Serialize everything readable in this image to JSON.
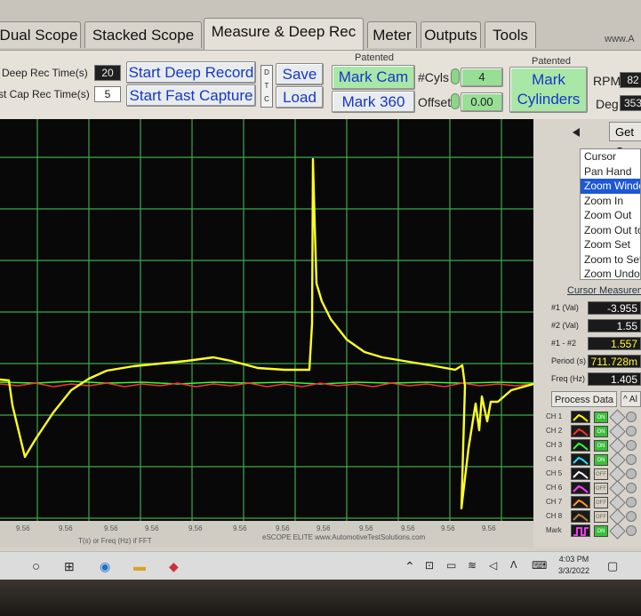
{
  "tabs": [
    "Dual Scope",
    "Stacked Scope",
    "Measure & Deep Rec",
    "Meter",
    "Outputs",
    "Tools"
  ],
  "active_tab": "Measure & Deep Rec",
  "url_fragment": "www.A",
  "controls": {
    "deep_rec_label": "Deep Rec Time(s)",
    "deep_rec_value": "20",
    "fast_cap_label": "st Cap Rec Time(s)",
    "fast_cap_value": "5",
    "start_deep_record": "Start Deep Record",
    "start_fast_capture": "Start Fast Capture",
    "dtc": "D T C",
    "save": "Save",
    "load": "Load",
    "patented_1": "Patented",
    "mark_cam": "Mark Cam",
    "mark_360": "Mark 360",
    "cyls_label": "#Cyls",
    "cyls_value": "4",
    "offset_label": "Offset",
    "offset_value": "0.00",
    "patented_2": "Patented",
    "mark_cylinders": "Mark Cylinders",
    "rpm_label": "RPM",
    "rpm_value": "82",
    "deg_label": "Deg",
    "deg_value": "353"
  },
  "right_panel": {
    "get_button": "Get C",
    "menu": [
      "Cursor",
      "Pan Hand",
      "Zoom Windo",
      "Zoom In",
      "Zoom Out",
      "Zoom Out to",
      "Zoom Set",
      "Zoom to Set",
      "Zoom Undo"
    ],
    "menu_selected": "Zoom Windo",
    "cursor_meas_title": "Cursor Measurem",
    "measurements": [
      {
        "label": "#1 (Val)",
        "value": "-3.955",
        "color": "#ffffff"
      },
      {
        "label": "#2 (Val)",
        "value": "1.55",
        "color": "#ffffff"
      },
      {
        "label": "#1 - #2",
        "value": "1.557",
        "color": "#ffff33"
      },
      {
        "label": "Period (s)",
        "value": "711.728m",
        "color": "#ffff33"
      },
      {
        "label": "Freq (Hz)",
        "value": "1.405",
        "color": "#ffffff"
      }
    ],
    "process_data": "Process Data",
    "al_button": "^ Al",
    "channels": [
      {
        "name": "CH 1",
        "state": "ON",
        "color": "#ffff00"
      },
      {
        "name": "CH 2",
        "state": "ON",
        "color": "#ff3030"
      },
      {
        "name": "CH 3",
        "state": "ON",
        "color": "#30ff30"
      },
      {
        "name": "CH 4",
        "state": "ON",
        "color": "#30e0ff"
      },
      {
        "name": "CH 5",
        "state": "OFF",
        "color": "#ffffff"
      },
      {
        "name": "CH 6",
        "state": "OFF",
        "color": "#ff40ff"
      },
      {
        "name": "CH 7",
        "state": "OFF",
        "color": "#ff9a30"
      },
      {
        "name": "CH 8",
        "state": "OFF",
        "color": "#c08040"
      },
      {
        "name": "Mark",
        "state": "ON",
        "color": "#ff40ff"
      }
    ]
  },
  "scope": {
    "tick_labels": [
      "9.56",
      "9.56",
      "9.56",
      "9.56",
      "9.56",
      "9.56",
      "9.56",
      "9.56",
      "9.56",
      "9.56",
      "9.56",
      "9.56"
    ],
    "x_caption": "T(s) or Freq (Hz) if FFT",
    "brand": "eSCOPE ELITE www.AutomotiveTestSolutions.com"
  },
  "taskbar": {
    "time": "4:03 PM",
    "date": "3/3/2022"
  }
}
